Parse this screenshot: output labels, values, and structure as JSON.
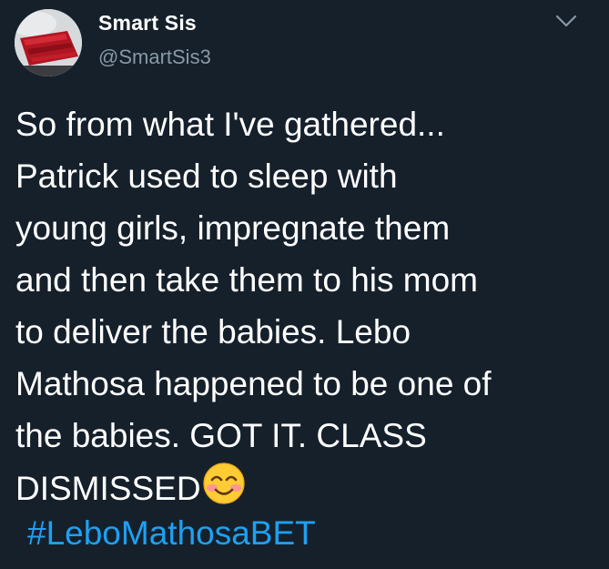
{
  "user": {
    "display_name": "Smart Sis",
    "handle": "@SmartSis3",
    "avatar_icon": "avatar-photo"
  },
  "menu": {
    "icon": "chevron-down-icon"
  },
  "tweet": {
    "text": "So from what I've gathered...\nPatrick used to sleep with\nyoung girls, impregnate them\nand then take them to his mom\nto deliver the babies. Lebo\nMathosa happened to be one of\nthe babies. GOT IT. CLASS\nDISMISSED",
    "emoji": "smiling-face-with-blushing-cheeks-emoji",
    "hashtag": "#LeboMathosaBET"
  },
  "colors": {
    "background": "#15202b",
    "text": "#ffffff",
    "secondary_text": "#8899a6",
    "link": "#1da1f2"
  }
}
